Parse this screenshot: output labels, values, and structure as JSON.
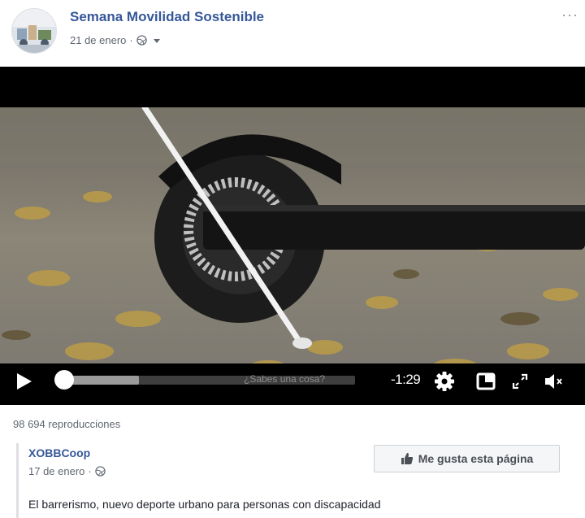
{
  "post": {
    "page_name": "Semana Movilidad Sostenible",
    "date": "21 de enero",
    "date_separator": "·",
    "more_label": "···"
  },
  "video": {
    "caption_hint": "¿Sabes una cosa?",
    "time_remaining": "-1:29",
    "progress_fraction": 0.0,
    "buffered_fraction": 0.27
  },
  "stats": {
    "views": "98 694 reproducciones"
  },
  "shared": {
    "page_name": "XOBBCoop",
    "date": "17 de enero",
    "date_separator": "·",
    "like_button_label": "Me gusta esta página",
    "description": "El barrerismo, nuevo deporte urbano para personas con discapacidad"
  },
  "colors": {
    "link_blue": "#365899",
    "meta_gray": "#606770",
    "button_bg": "#f5f6f7"
  },
  "icons": [
    "globe-icon",
    "caret-down-icon",
    "more-icon",
    "play-icon",
    "settings-gear-icon",
    "pip-icon",
    "fullscreen-icon",
    "volume-muted-icon",
    "thumbs-up-icon"
  ]
}
